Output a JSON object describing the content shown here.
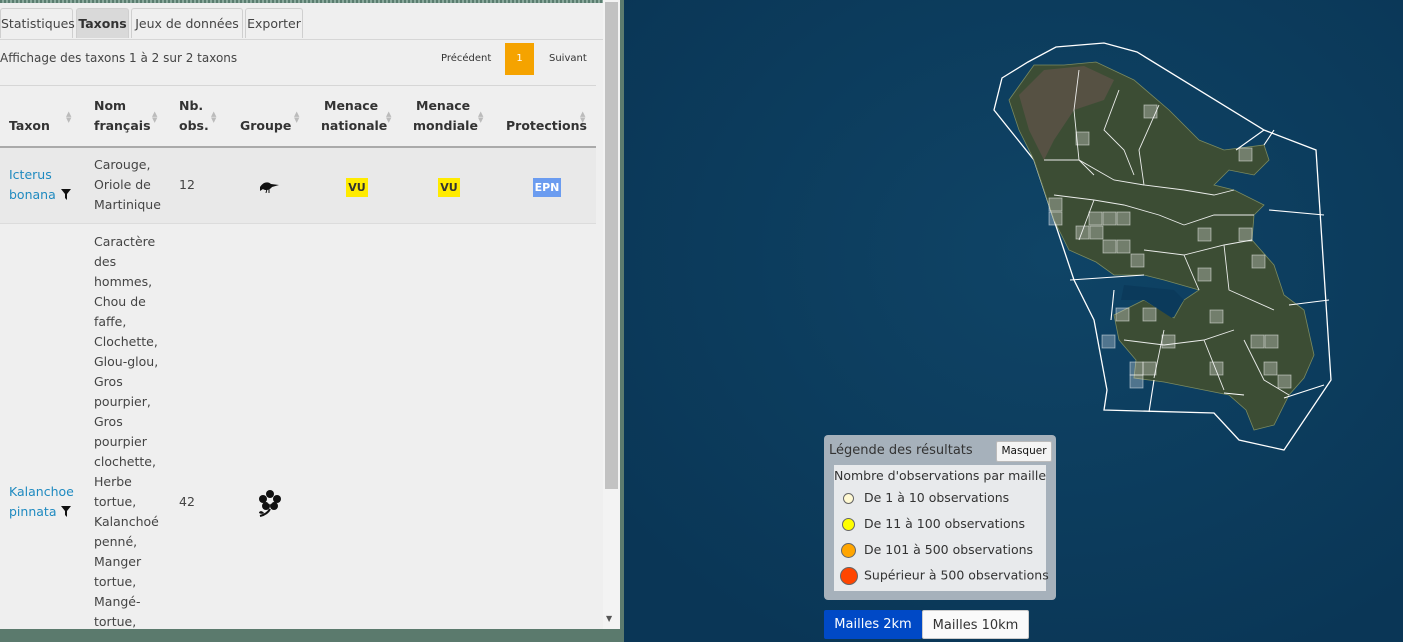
{
  "tabs": [
    {
      "label": "Statistiques"
    },
    {
      "label": "Taxons"
    },
    {
      "label": "Jeux de données"
    },
    {
      "label": "Exporter"
    }
  ],
  "table_info": "Affichage des taxons 1 à 2 sur 2 taxons",
  "pagination": {
    "prev": "Précédent",
    "current": "1",
    "next": "Suivant"
  },
  "columns": {
    "taxon": "Taxon",
    "nom1": "Nom",
    "nom2": "français",
    "nb1": "Nb.",
    "nb2": "obs.",
    "groupe": "Groupe",
    "mn1": "Menace",
    "mn2": "nationale",
    "mm1": "Menace",
    "mm2": "mondiale",
    "protections": "Protections"
  },
  "rows": [
    {
      "taxon1": "Icterus",
      "taxon2": "bonana",
      "nom_lines": [
        "Carouge,",
        "Oriole de",
        "Martinique"
      ],
      "nb_obs": "12",
      "groupe_icon": "bird-icon",
      "menace_nationale": "VU",
      "menace_mondiale": "VU",
      "protection": "EPN"
    },
    {
      "taxon1": "Kalanchoe",
      "taxon2": "pinnata",
      "nom_lines": [
        "Caractère",
        "des",
        "hommes,",
        "Chou de",
        "faffe,",
        "Clochette,",
        "Glou-glou,",
        "Gros",
        "pourpier,",
        "Gros",
        "pourpier",
        "clochette,",
        "Herbe",
        "tortue,",
        "Kalanchoé",
        "penné,",
        "Manger",
        "tortue,",
        "Mangé-",
        "tortue,"
      ],
      "nb_obs": "42",
      "groupe_icon": "plant-icon"
    }
  ],
  "legend": {
    "title": "Légende des résultats",
    "hide_button": "Masquer",
    "subtitle": "Nombre d'observations par maille",
    "items": [
      {
        "label": "De 1 à 10 observations",
        "color": "#fff9d2"
      },
      {
        "label": "De 11 à 100 observations",
        "color": "#ffff00"
      },
      {
        "label": "De 101 à 500 observations",
        "color": "#ffa500"
      },
      {
        "label": "Supérieur à 500 observations",
        "color": "#ff4500"
      }
    ]
  },
  "grid_buttons": {
    "km2": "Mailles 2km",
    "km10": "Mailles 10km"
  },
  "colors": {
    "accent": "#f5a300",
    "link": "#1f8ac0",
    "map_sea": "#0b3a5b"
  }
}
